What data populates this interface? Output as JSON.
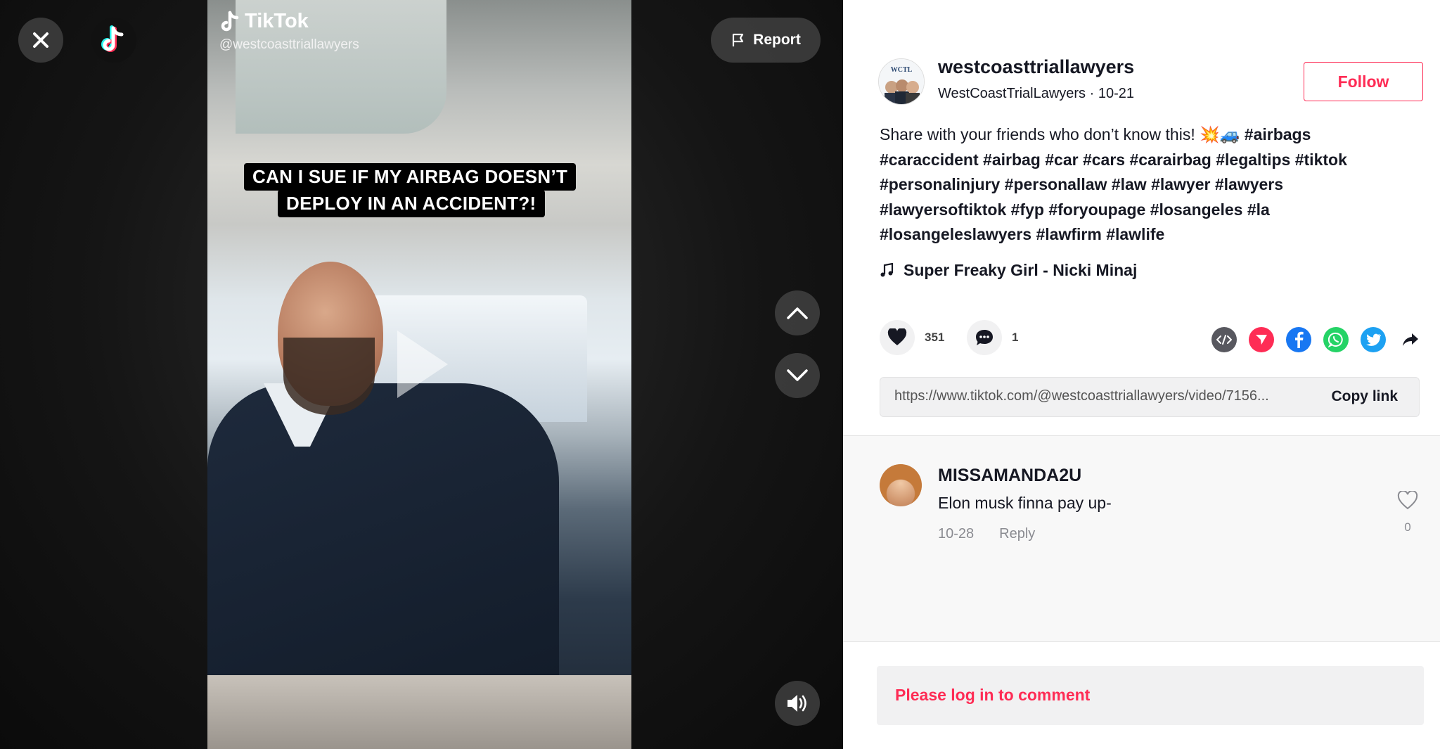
{
  "brand": {
    "name": "TikTok",
    "accent": "#fe2c55"
  },
  "video": {
    "watermark_brand": "TikTok",
    "watermark_user": "@westcoasttriallawyers",
    "caption_line1": "CAN I SUE IF MY AIRBAG DOESN’T",
    "caption_line2": "DEPLOY IN AN ACCIDENT?!",
    "report_label": "Report",
    "icons": {
      "close": "close-icon",
      "logo": "tiktok-logo-icon",
      "report": "flag-icon",
      "up": "chevron-up-icon",
      "down": "chevron-down-icon",
      "volume": "volume-icon",
      "play": "play-icon"
    }
  },
  "author": {
    "username": "westcoasttriallawyers",
    "display_name": "WestCoastTrialLawyers",
    "separator": " · ",
    "date": "10-21",
    "avatar_text": "WCTL",
    "follow_label": "Follow"
  },
  "description": {
    "text": "Share with your friends who don’t know this! 💥🚙",
    "tags": [
      "#airbags",
      "#caraccident",
      "#airbag",
      "#car",
      "#cars",
      "#carairbag",
      "#legaltips",
      "#tiktok",
      "#personalinjury",
      "#personallaw",
      "#law",
      "#lawyer",
      "#lawyers",
      "#lawyersoftiktok",
      "#fyp",
      "#foryoupage",
      "#losangeles",
      "#la",
      "#losangeleslawyers",
      "#lawfirm",
      "#lawlife"
    ]
  },
  "music": {
    "title": "Super Freaky Girl - Nicki Minaj",
    "icon": "music-note-icon"
  },
  "stats": {
    "likes": "351",
    "comments": "1"
  },
  "share": {
    "icons": [
      "embed-icon",
      "send-icon",
      "facebook-icon",
      "whatsapp-icon",
      "twitter-icon",
      "share-arrow-icon"
    ],
    "colors": {
      "embed": "#58585f",
      "send": "#fe2c55",
      "facebook": "#1877f2",
      "whatsapp": "#25d366",
      "twitter": "#1da1f2"
    }
  },
  "link": {
    "url": "https://www.tiktok.com/@westcoasttriallawyers/video/7156...",
    "copy_label": "Copy link"
  },
  "comments": [
    {
      "user": "MISSAMANDA2U",
      "text": "Elon musk finna pay up-",
      "date": "10-28",
      "reply_label": "Reply",
      "likes": "0"
    }
  ],
  "login_prompt": "Please log in to comment"
}
